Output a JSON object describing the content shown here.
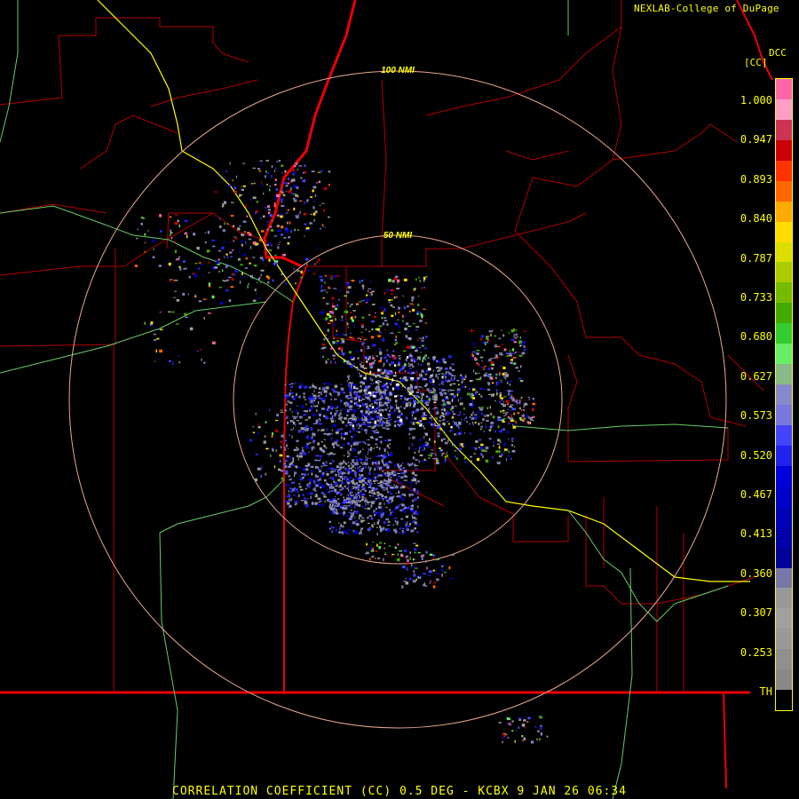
{
  "credit": "NEXLAB-College of DuPage",
  "product_code": "DCC",
  "units": "[CC]",
  "range_rings": [
    "100 NMI",
    "50 NMI"
  ],
  "legend": {
    "ticks": [
      "1.000",
      "0.947",
      "0.893",
      "0.840",
      "0.787",
      "0.733",
      "0.680",
      "0.627",
      "0.573",
      "0.520",
      "0.467",
      "0.413",
      "0.360",
      "0.307",
      "0.253",
      "TH"
    ],
    "colors": [
      "#ff66aa",
      "#ff9fc8",
      "#cc3355",
      "#cc0000",
      "#ff3300",
      "#ff6600",
      "#ffaa00",
      "#ffdd00",
      "#dddd00",
      "#aacc00",
      "#77bb00",
      "#44aa00",
      "#33cc33",
      "#66ee66",
      "#88bb88",
      "#8888cc",
      "#7777dd",
      "#4444ff",
      "#2222ee",
      "#0000dd",
      "#0000cc",
      "#0000bb",
      "#0000aa",
      "#000099",
      "#7777aa",
      "#999999",
      "#a0a0a0",
      "#999999",
      "#909090",
      "#888888",
      "#000000"
    ]
  },
  "footer": "CORRELATION COEFFICIENT (CC) 0.5 DEG - KCBX 9 JAN 26 06:34"
}
